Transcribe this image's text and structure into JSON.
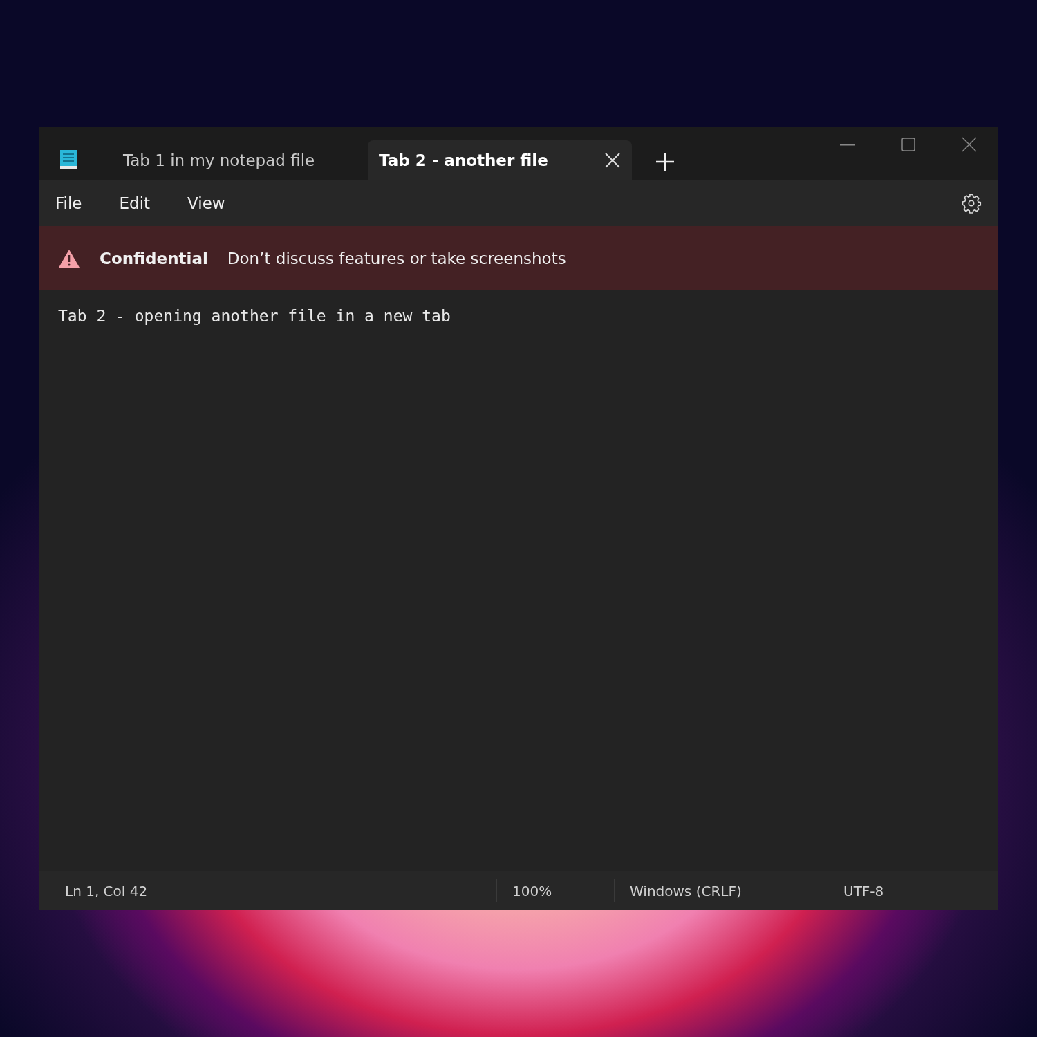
{
  "tabs": [
    {
      "label": "Tab 1 in my notepad file",
      "selected": false
    },
    {
      "label": "Tab 2 - another file",
      "selected": true
    }
  ],
  "menu": [
    "File",
    "Edit",
    "View"
  ],
  "banner": {
    "title": "Confidential",
    "message": "Don’t discuss features or take screenshots"
  },
  "editor": {
    "text": "Tab 2 - opening another file in a new tab"
  },
  "status_bar": [
    "Ln 1, Col 42",
    "100%",
    "Windows (CRLF)",
    "UTF-8"
  ]
}
